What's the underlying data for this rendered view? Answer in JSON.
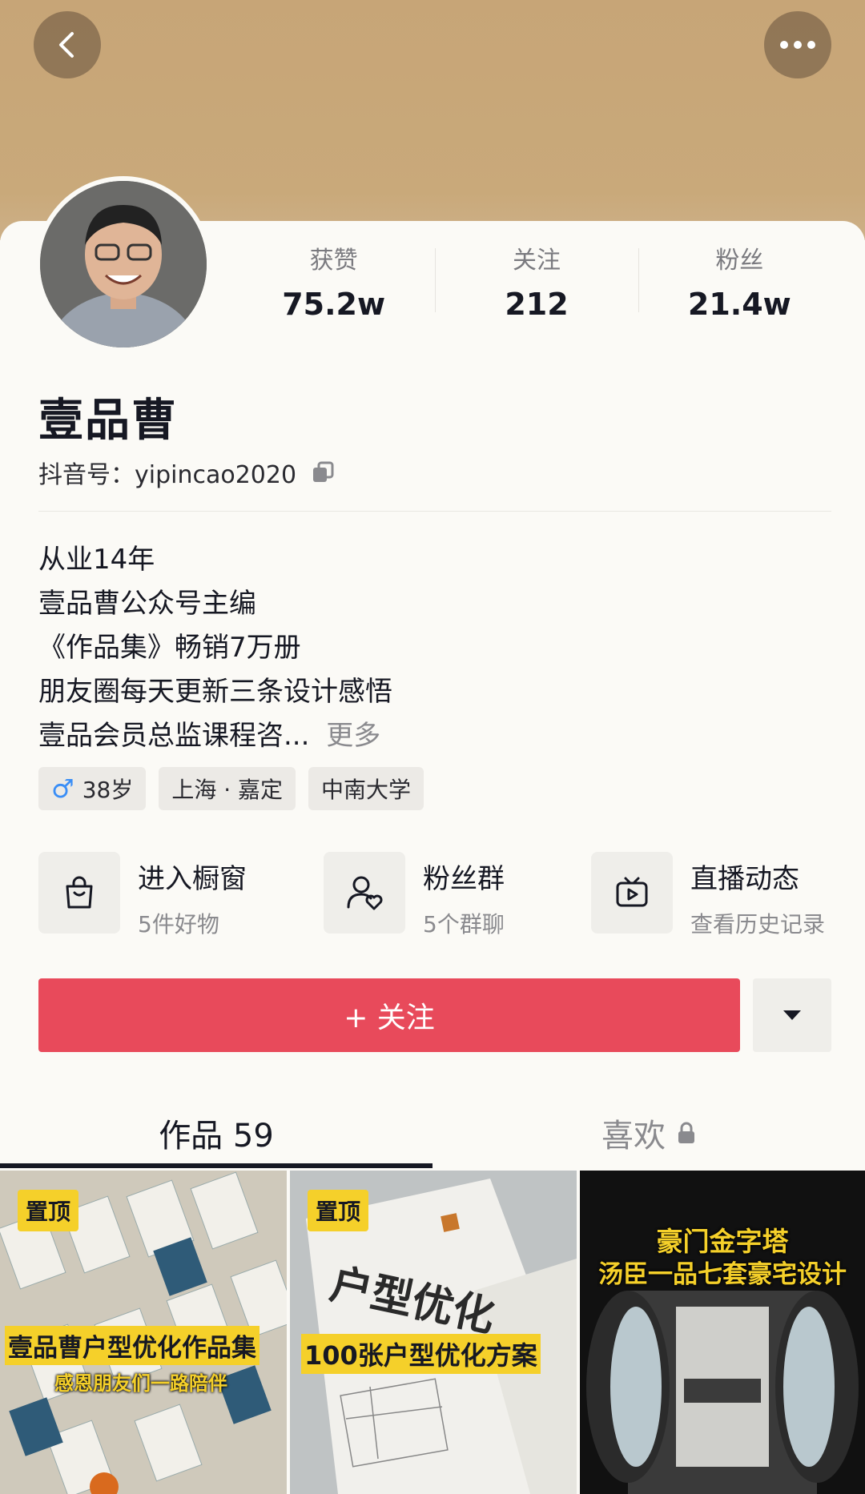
{
  "header": {
    "back_icon": "chevron-left-icon",
    "more_icon": "more-dots-icon",
    "banner_color": "#c8a677"
  },
  "profile": {
    "name": "壹品曹",
    "uid": "抖音号：yipincao2020",
    "stats": [
      {
        "label": "获赞",
        "value": "75.2w"
      },
      {
        "label": "关注",
        "value": "212"
      },
      {
        "label": "粉丝",
        "value": "21.4w"
      }
    ],
    "bio": [
      "从业14年",
      "壹品曹公众号主编",
      "《作品集》畅销7万册",
      "朋友圈每天更新三条设计感悟",
      "壹品会员总监课程咨..."
    ],
    "more_label": "更多",
    "tags": [
      {
        "text": "38岁",
        "icon": "male-icon"
      },
      {
        "text": "上海 · 嘉定"
      },
      {
        "text": "中南大学"
      }
    ]
  },
  "entries": [
    {
      "title": "进入橱窗",
      "subtitle": "5件好物",
      "icon": "shopping-bag-icon"
    },
    {
      "title": "粉丝群",
      "subtitle": "5个群聊",
      "icon": "fan-group-icon"
    },
    {
      "title": "直播动态",
      "subtitle": "查看历史记录",
      "icon": "live-tv-icon"
    }
  ],
  "actions": {
    "follow_label": "+ 关注",
    "follow_color": "#e84a5b"
  },
  "tabs": {
    "works": "作品 59",
    "likes": "喜欢"
  },
  "videos": [
    {
      "pin": "置顶",
      "caption": "壹品曹户型优化作品集",
      "subcaption": "感恩朋友们一路陪伴"
    },
    {
      "pin": "置顶",
      "caption": "100张户型优化方案",
      "cover_text": "户型优化"
    },
    {
      "caption_line1": "豪门金字塔",
      "caption_line2": "汤臣一品七套豪宅设计"
    }
  ]
}
